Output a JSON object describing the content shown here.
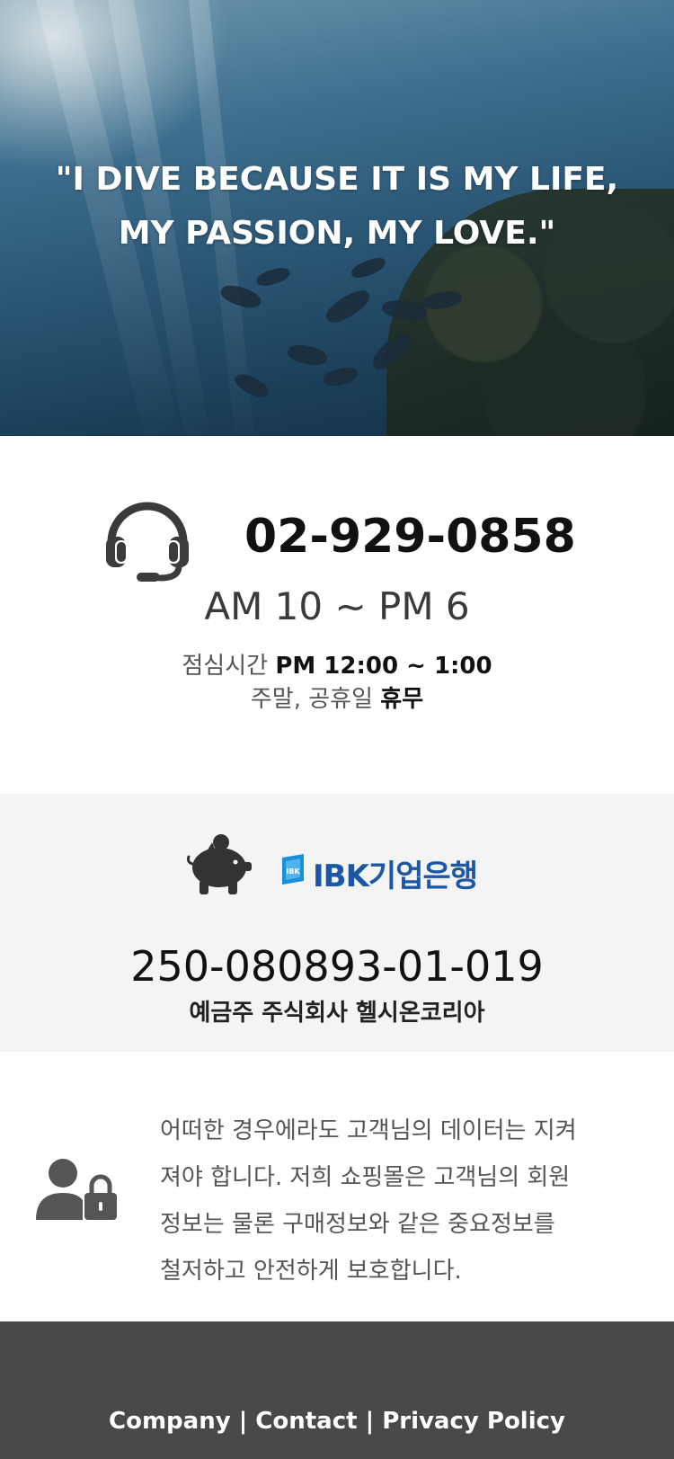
{
  "hero": {
    "quote_line1": "\"I DIVE BECAUSE IT IS MY LIFE,",
    "quote_line2": "MY PASSION, MY LOVE.\""
  },
  "contact": {
    "icon": "headset-icon",
    "phone": "02-929-0858",
    "hours": "AM 10 ~ PM 6",
    "lunch_label": "점심시간",
    "lunch_time": "PM 12:00 ~ 1:00",
    "weekend_label": "주말, 공휴일",
    "weekend_status": "휴무"
  },
  "bank": {
    "icon": "piggy-bank-icon",
    "bank_name": "IBK기업은행",
    "logo_text": "IBK",
    "account_number": "250-080893-01-019",
    "account_holder": "예금주 주식회사 헬시온코리아"
  },
  "privacy": {
    "icon": "user-lock-icon",
    "line1": "어떠한 경우에라도 고객님의 데이터는 지켜",
    "line2": "져야 합니다. 저희 쇼핑몰은 고객님의 회원",
    "line3": "정보는 물론 구매정보와 같은 중요정보를",
    "line4": "철저하고 안전하게 보호합니다."
  },
  "footer": {
    "company": "Company",
    "contact": "Contact",
    "privacy_policy": "Privacy Policy",
    "separator": "|"
  },
  "colors": {
    "footer_bg": "#494949",
    "bank_bg": "#f4f4f4",
    "ibk_blue": "#1a57a8"
  }
}
